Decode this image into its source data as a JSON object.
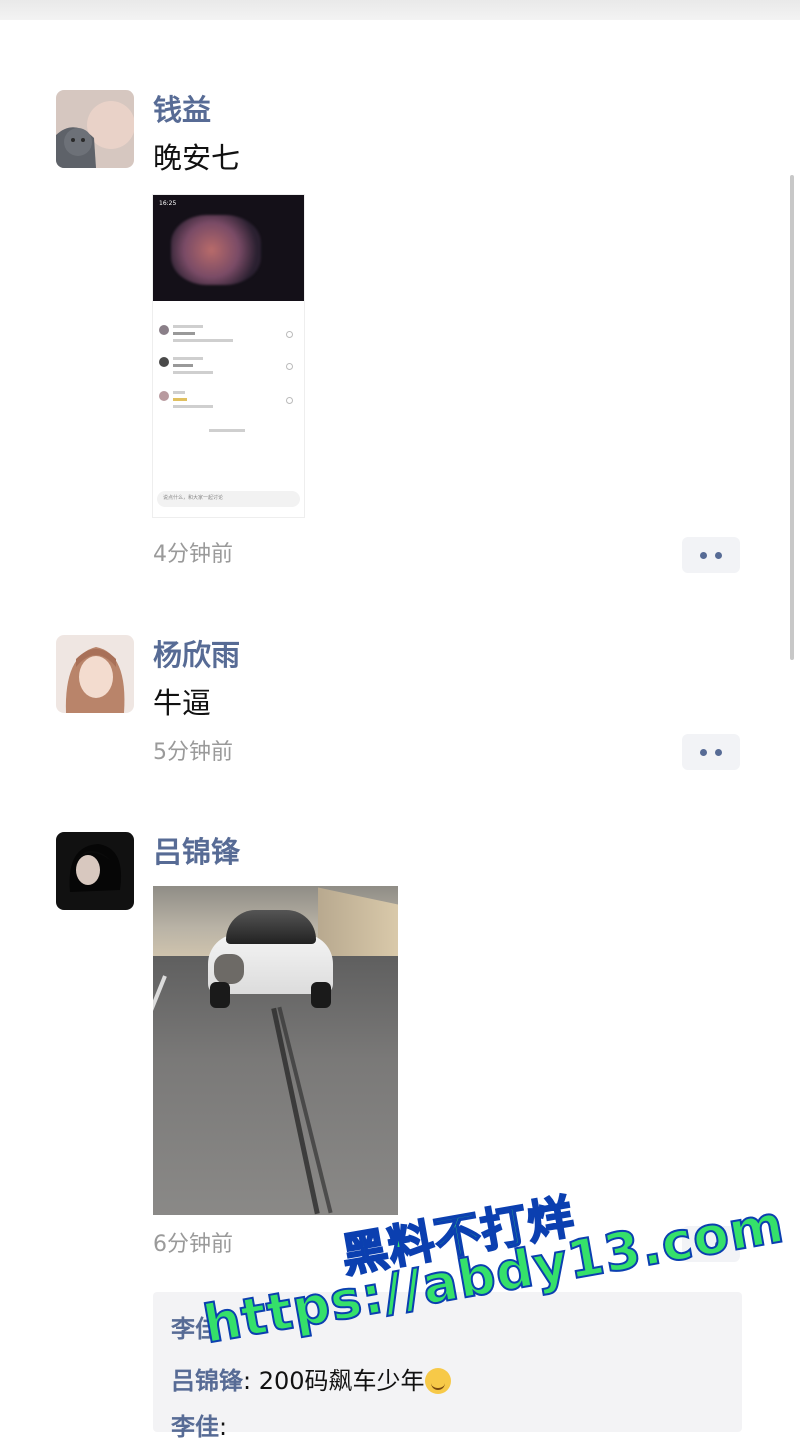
{
  "posts": [
    {
      "author": "钱益",
      "text": "晚安七",
      "time": "4分钟前",
      "image": {
        "statusbar_time": "16:25",
        "input_placeholder": "说点什么，和大家一起讨论"
      }
    },
    {
      "author": "杨欣雨",
      "text": "牛逼",
      "time": "5分钟前"
    },
    {
      "author": "吕锦锋",
      "time": "6分钟前",
      "comments": {
        "like_line": "李佳",
        "items": [
          {
            "name": "吕锦锋",
            "sep": ": ",
            "text": "200码飙车少年",
            "emoji": "crying-laughing-emoji"
          },
          {
            "name": "李佳",
            "sep": ": ",
            "text": ""
          }
        ]
      }
    }
  ],
  "watermark": {
    "line1": "黑料不打烊",
    "line2": "https://abdy13.com"
  },
  "colors": {
    "name": "#576b95",
    "time": "#9a9a9a",
    "watermark_fill": "#35e06a",
    "watermark_stroke": "#0b3fb0"
  }
}
